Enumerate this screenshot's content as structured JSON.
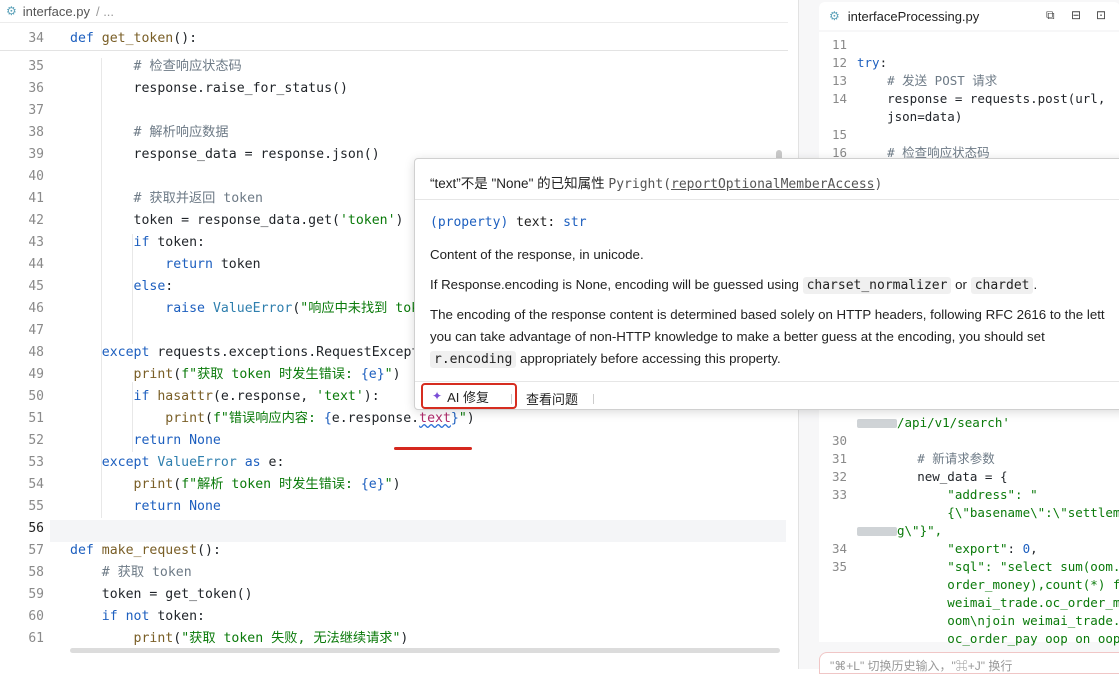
{
  "left_editor": {
    "tab_filename": "interface.py",
    "breadcrumb_rest": "/ ...",
    "sticky_header": "def get_token():",
    "lines": [
      {
        "n": "35",
        "segs": [
          [
            "cm",
            "        # 检查响应状态码"
          ]
        ]
      },
      {
        "n": "36",
        "segs": [
          [
            "",
            "        response.raise_for_status()"
          ]
        ]
      },
      {
        "n": "37",
        "segs": [
          [
            "",
            ""
          ]
        ]
      },
      {
        "n": "38",
        "segs": [
          [
            "cm",
            "        # 解析响应数据"
          ]
        ]
      },
      {
        "n": "39",
        "segs": [
          [
            "",
            "        response_data = response.json()"
          ]
        ]
      },
      {
        "n": "40",
        "segs": [
          [
            "",
            ""
          ]
        ]
      },
      {
        "n": "41",
        "segs": [
          [
            "cm",
            "        # 获取并返回 token"
          ]
        ]
      },
      {
        "n": "42",
        "segs": [
          [
            "",
            "        token = response_data.get("
          ],
          [
            "st",
            "'token'"
          ],
          [
            "",
            ")"
          ]
        ]
      },
      {
        "n": "43",
        "segs": [
          [
            "kw",
            "        if"
          ],
          [
            "",
            " token:"
          ]
        ]
      },
      {
        "n": "44",
        "segs": [
          [
            "kw",
            "            return"
          ],
          [
            "",
            " token"
          ]
        ]
      },
      {
        "n": "45",
        "segs": [
          [
            "kw",
            "        else"
          ],
          [
            "",
            ":"
          ]
        ]
      },
      {
        "n": "46",
        "segs": [
          [
            "kw",
            "            raise"
          ],
          [
            "",
            " "
          ],
          [
            "bi",
            "ValueError"
          ],
          [
            "",
            "("
          ],
          [
            "st",
            "\"响应中未找到 tok"
          ]
        ]
      },
      {
        "n": "47",
        "segs": [
          [
            "",
            ""
          ]
        ]
      },
      {
        "n": "48",
        "segs": [
          [
            "kw",
            "    except"
          ],
          [
            "",
            " requests.exceptions.RequestExcept"
          ]
        ]
      },
      {
        "n": "49",
        "segs": [
          [
            "",
            "        "
          ],
          [
            "fn",
            "print"
          ],
          [
            "",
            "("
          ],
          [
            "st",
            "f\"获取 token 时发生错误: "
          ],
          [
            "kw",
            "{e}"
          ],
          [
            "st",
            "\""
          ],
          [
            "",
            ")"
          ]
        ]
      },
      {
        "n": "50",
        "segs": [
          [
            "kw",
            "        if"
          ],
          [
            "",
            " "
          ],
          [
            "fn",
            "hasattr"
          ],
          [
            "",
            "(e.response, "
          ],
          [
            "st",
            "'text'"
          ],
          [
            "",
            "):"
          ]
        ]
      },
      {
        "n": "51",
        "segs": [
          [
            "",
            "            "
          ],
          [
            "fn",
            "print"
          ],
          [
            "",
            "("
          ],
          [
            "st",
            "f\"错误响应内容: "
          ],
          [
            "kw",
            "{"
          ],
          [
            "",
            "e.response."
          ],
          [
            "er",
            "text"
          ],
          [
            "kw",
            "}"
          ],
          [
            "st",
            "\""
          ],
          [
            "",
            ")"
          ]
        ]
      },
      {
        "n": "52",
        "segs": [
          [
            "kw",
            "        return"
          ],
          [
            "",
            " "
          ],
          [
            "kw",
            "None"
          ]
        ]
      },
      {
        "n": "53",
        "segs": [
          [
            "kw",
            "    except"
          ],
          [
            "",
            " "
          ],
          [
            "bi",
            "ValueError"
          ],
          [
            "",
            " "
          ],
          [
            "kw",
            "as"
          ],
          [
            "",
            " e:"
          ]
        ]
      },
      {
        "n": "54",
        "segs": [
          [
            "",
            "        "
          ],
          [
            "fn",
            "print"
          ],
          [
            "",
            "("
          ],
          [
            "st",
            "f\"解析 token 时发生错误: "
          ],
          [
            "kw",
            "{e}"
          ],
          [
            "st",
            "\""
          ],
          [
            "",
            ")"
          ]
        ]
      },
      {
        "n": "55",
        "segs": [
          [
            "kw",
            "        return"
          ],
          [
            "",
            " "
          ],
          [
            "kw",
            "None"
          ]
        ]
      },
      {
        "n": "56",
        "segs": [
          [
            "",
            ""
          ]
        ]
      },
      {
        "n": "57",
        "segs": [
          [
            "kw",
            "def"
          ],
          [
            "",
            " "
          ],
          [
            "fn",
            "make_request"
          ],
          [
            "",
            "():"
          ]
        ]
      },
      {
        "n": "58",
        "segs": [
          [
            "cm",
            "    # 获取 token"
          ]
        ]
      },
      {
        "n": "59",
        "segs": [
          [
            "",
            "    token = get_token()"
          ]
        ]
      },
      {
        "n": "60",
        "segs": [
          [
            "kw",
            "    if not"
          ],
          [
            "",
            " token:"
          ]
        ]
      },
      {
        "n": "61",
        "segs": [
          [
            "",
            "        "
          ],
          [
            "fn",
            "print"
          ],
          [
            "",
            "("
          ],
          [
            "st",
            "\"获取 token 失败, 无法继续请求\""
          ],
          [
            "",
            ")"
          ]
        ]
      }
    ],
    "current_line": "56"
  },
  "right_editor": {
    "tab_filename": "interfaceProcessing.py",
    "lines": [
      {
        "n": "11",
        "segs": [
          [
            "",
            ""
          ]
        ]
      },
      {
        "n": "12",
        "segs": [
          [
            "kw",
            "try"
          ],
          [
            "",
            ":"
          ]
        ]
      },
      {
        "n": "13",
        "segs": [
          [
            "cm",
            "    # 发送 POST 请求"
          ]
        ]
      },
      {
        "n": "14",
        "segs": [
          [
            "",
            "    response = requests.post(url,"
          ]
        ]
      },
      {
        "n": "",
        "segs": [
          [
            "",
            "    json=data)"
          ]
        ]
      },
      {
        "n": "15",
        "segs": [
          [
            "",
            ""
          ]
        ]
      },
      {
        "n": "16",
        "segs": [
          [
            "cm",
            "    # 检查响应状态码"
          ]
        ]
      }
    ],
    "lines_bottom": [
      {
        "n": "",
        "segs": [
          [
            "blur",
            ""
          ],
          [
            "st",
            "/api/v1/search'"
          ]
        ]
      },
      {
        "n": "30",
        "segs": [
          [
            "",
            ""
          ]
        ]
      },
      {
        "n": "31",
        "segs": [
          [
            "cm",
            "        # 新请求参数"
          ]
        ]
      },
      {
        "n": "32",
        "segs": [
          [
            "",
            "        new_data = {"
          ]
        ]
      },
      {
        "n": "33",
        "segs": [
          [
            "st",
            "            \"address\": \""
          ]
        ]
      },
      {
        "n": "",
        "segs": [
          [
            "st",
            "            {\\\"basename\\\":\\\"settlemer"
          ]
        ]
      },
      {
        "n": "",
        "segs": [
          [
            "blur",
            ""
          ],
          [
            "st",
            "g\\\"}\","
          ]
        ]
      },
      {
        "n": "34",
        "segs": [
          [
            "st",
            "            \"export\""
          ],
          [
            "",
            ": "
          ],
          [
            "kw",
            "0"
          ],
          [
            "",
            ","
          ]
        ]
      },
      {
        "n": "35",
        "segs": [
          [
            "st",
            "            \"sql\": \"select sum(oom."
          ]
        ]
      },
      {
        "n": "",
        "segs": [
          [
            "st",
            "            order_money),count(*) fro"
          ]
        ]
      },
      {
        "n": "",
        "segs": [
          [
            "st",
            "            weimai_trade.oc_order_mai"
          ]
        ]
      },
      {
        "n": "",
        "segs": [
          [
            "st",
            "            oom\\njoin weimai_trade."
          ]
        ]
      },
      {
        "n": "",
        "segs": [
          [
            "st",
            "            oc_order_pay oop on oop."
          ]
        ]
      }
    ],
    "input_hint": "\"⌘+L\" 切换历史输入，\"⌘+J\" 换行"
  },
  "popup": {
    "header_msg": "“text”不是 \"None\" 的已知属性",
    "header_source": "Pyright",
    "header_rule": "reportOptionalMemberAccess",
    "sig_kind": "(property)",
    "sig_name": "text:",
    "sig_type": "str",
    "para1": "Content of the response, in unicode.",
    "para2_a": "If Response.encoding is None, encoding will be guessed using",
    "para2_code1": "charset_normalizer",
    "para2_b": "or",
    "para2_code2": "chardet",
    "para2_c": ".",
    "para3_a": "The encoding of the response content is determined based solely on HTTP headers, following RFC 2616 to the lett",
    "para3_b": "you can take advantage of non-HTTP knowledge to make a better guess at the encoding, you should set",
    "para3_code": "r.encoding",
    "para3_c": "appropriately before accessing this property.",
    "ai_fix_label": "AI 修复",
    "view_problem_label": "查看问题"
  },
  "colors": {
    "highlight_box": "#d62d20",
    "underline": "#d5281e",
    "keyword": "#1d5fbf",
    "string": "#0a7a0a"
  }
}
